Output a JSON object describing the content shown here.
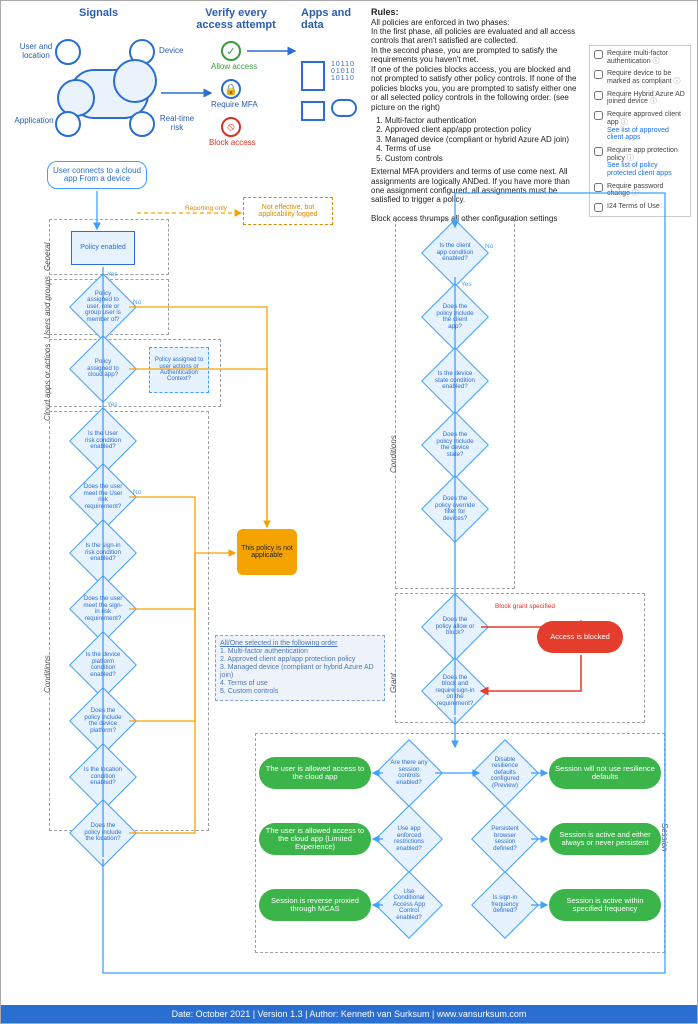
{
  "header": {
    "title_signals": "Signals",
    "title_verify": "Verify every access attempt",
    "title_apps": "Apps and data",
    "labels": {
      "user_location": "User and location",
      "device": "Device",
      "application": "Application",
      "real_time_risk": "Real-time risk",
      "allow_access": "Allow access",
      "require_mfa": "Require MFA",
      "block_access": "Block access"
    }
  },
  "rules": {
    "heading": "Rules:",
    "p1": "All policies are enforced in two phases:",
    "p2": "In the first phase, all policies are evaluated and all access controls that aren't satisfied are collected.",
    "p3": "In the second phase, you are prompted to satisfy the requirements you haven't met.",
    "p4": "If one of the policies blocks access, you are blocked and not prompted to satisfy other policy controls. If none of the policies blocks you, you are prompted to satisfy either one or all selected policy controls in the following order. (see picture on the right)",
    "list": [
      "Multi-factor authentication",
      "Approved client app/app protection policy",
      "Managed device (compliant or hybrid Azure AD join)",
      "Terms of use",
      "Custom controls"
    ],
    "p5": "External MFA providers and terms of use come next. All assignments are logically ANDed. If you have more than one assignment configured, all assignments must be satisfied to trigger a policy.",
    "p6": "Block access thrumps all other configuration settings"
  },
  "checkboxes": [
    {
      "label": "Require multi-factor authentication",
      "sub": ""
    },
    {
      "label": "Require device to be marked as compliant",
      "sub": ""
    },
    {
      "label": "Require Hybrid Azure AD joined device",
      "sub": ""
    },
    {
      "label": "Require approved client app",
      "sub": "See list of approved client apps"
    },
    {
      "label": "Require app protection policy",
      "sub": "See list of policy protected client apps"
    },
    {
      "label": "Require password change",
      "sub": ""
    },
    {
      "label": "I24 Terms of Use",
      "sub": ""
    }
  ],
  "flow": {
    "start": "User connects to a cloud app From a device",
    "report_only": "Reporting only",
    "not_effective": "Not effective, but applicability logged",
    "policy_enabled": "Policy enabled",
    "policy_not_applicable": "This policy is not applicable",
    "access_blocked": "Access is blocked",
    "block_set": "Block grant specified",
    "order_heading": "All/One selected in the following order",
    "order_items": [
      "1. Multi-factor authentication",
      "2. Approved client app/app protection policy",
      "3. Managed device (compliant or hybrid Azure AD join)",
      "4. Terms of use",
      "5. Custom controls"
    ],
    "left_diamonds": [
      "Policy assigned to user, role or group user is member of?",
      "Policy assigned to cloud app?",
      "Is the User risk condition enabled?",
      "Does the user meet the User risk requirement?",
      "Is the sign-in risk condition enabled?",
      "Does the user meet the sign-in risk requirement?",
      "Is the device platform condition enabled?",
      "Does the policy include the device platform?",
      "Is the location condition enabled?",
      "Does the policy include the location?"
    ],
    "left_note": "Policy assigned to user actions or Authentication Context?",
    "right_diamonds": [
      "Is the client app condition enabled?",
      "Does the policy include the client app?",
      "Is the device state condition enabled?",
      "Does the policy include the device state?",
      "Does the policy override filter for devices?",
      "Does the policy allow or block?",
      "Does the block and require sign-in on the requirement?"
    ],
    "session_diamonds": [
      "Are there any session controls enabled?",
      "Use app enforced restrictions enabled?",
      "Use Conditional Access App Control enabled?",
      "Disable resilience defaults configured (Preview)",
      "Persistent browser session defined?",
      "Is sign-in frequency defined?"
    ],
    "outcomes": {
      "allowed": "The user is allowed access to the cloud app",
      "allowed_limited": "The user is allowed access to the cloud app (Limited Experience)",
      "mcas": "Session is reverse proxied through MCAS",
      "no_resilience": "Session will not use resilience defaults",
      "persistent": "Session is active and either always or never persistent",
      "frequency": "Session is active within specified frequency"
    },
    "groups": {
      "general": "General",
      "users_groups": "Users and groups",
      "cloud_apps": "Cloud apps or actions",
      "conditions_left": "Conditions",
      "conditions_right": "Conditions",
      "grant": "Grant",
      "session": "Session"
    },
    "yes": "Yes",
    "no": "No"
  },
  "footer": "Date: October 2021 | Version 1.3 | Author: Kenneth van Surksum | www.vansurksum.com"
}
